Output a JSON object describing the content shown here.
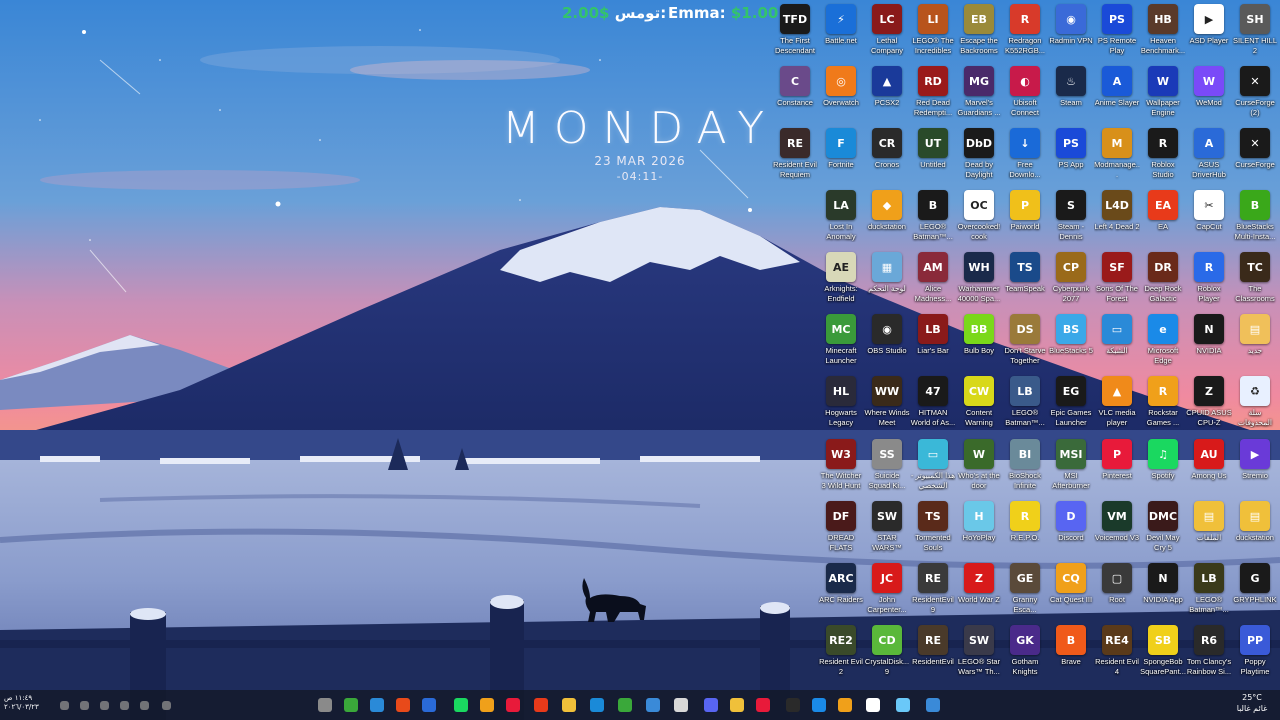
{
  "widget": {
    "day": "MONDAY",
    "date": "23 MAR 2026",
    "time": "-04:11-"
  },
  "topbar": {
    "left_money": "2.00$",
    "left_name": "تومس:",
    "right_name": "Emma:",
    "right_money": "$1.00"
  },
  "colors": {
    "money": "#33c46a",
    "sky_top": "#3a7fd0",
    "sky_mid": "#e27fa0",
    "sky_low": "#f49a6e",
    "mountain": "#283a7a",
    "snow": "#c9d2ea",
    "taskbar": "#121622"
  },
  "icons": [
    [
      "The First Descendant",
      "Battle.net",
      "Lethal Company",
      "LEGO® The Incredibles",
      "Escape the Backrooms",
      "Redragon K552RGB...",
      "Radmin VPN",
      "PS Remote Play",
      "Heaven Benchmark...",
      "ASD Player",
      "SILENT HILL 2"
    ],
    [
      "Constance",
      "Overwatch",
      "PCSX2",
      "Red Dead Redempti...",
      "Marvel's Guardians ...",
      "Ubisoft Connect",
      "Steam",
      "Anime Slayer",
      "Wallpaper Engine",
      "WeMod",
      "CurseForge (2)"
    ],
    [
      "Resident Evil Requiem",
      "Fortnite",
      "Cronos",
      "Untitled",
      "Dead by Daylight",
      "Free Downlo...",
      "PS App",
      "Modmanage...",
      "Roblox Studio",
      "ASUS DriverHub",
      "CurseForge"
    ],
    [
      "Lost In Anomaly",
      "duckstation",
      "LEGO® Batman™...",
      "Overcooked! cook",
      "Paiworld",
      "Steam - Dennis",
      "Left 4 Dead 2",
      "EA",
      "CapCut",
      "BlueStacks Multi-Insta..."
    ],
    [
      "Arknights: Endfield",
      "لوحة التحكم",
      "Alice Madness...",
      "Warhammer 40000 Spa...",
      "TeamSpeak",
      "Cyberpunk 2077",
      "Sons Of The Forest",
      "Deep Rock Galactic",
      "Roblox Player",
      "The Classrooms"
    ],
    [
      "Minecraft Launcher",
      "OBS Studio",
      "Liar's Bar",
      "Bulb Boy",
      "Don't Starve Together",
      "BlueStacks 5",
      "الشبكة",
      "Microsoft Edge",
      "NVIDIA",
      "جديد"
    ],
    [
      "Hogwarts Legacy",
      "Where Winds Meet",
      "HITMAN World of As...",
      "Content Warning",
      "LEGO® Batman™...",
      "Epic Games Launcher",
      "VLC media player",
      "Rockstar Games ...",
      "CPUID ASUS CPU-Z",
      "سلة المحذوفات"
    ],
    [
      "The Witcher 3 Wild Hunt",
      "Suicide Squad Ki...",
      "هذا الكمبيوتر - الشخصي",
      "Who's at the door",
      "BioShock Infinite",
      "MSI Afterburner",
      "Pinterest",
      "Spotify",
      "Among Us",
      "Stremio"
    ],
    [
      "DREAD FLATS",
      "STAR WARS™ Battlefro...",
      "Tormented Souls",
      "HoYoPlay",
      "R.E.P.O.",
      "Discord",
      "Voicemod V3",
      "Devil May Cry 5",
      "الملفات",
      "duckstation"
    ],
    [
      "ARC Raiders",
      "John Carpenter...",
      "ResidentEvil 9",
      "World War Z",
      "Granny Esca...",
      "Cat Quest III",
      "Root",
      "NVIDIA App",
      "LEGO® Batman™...",
      "GRYPHLINK"
    ],
    [
      "Resident Evil 2",
      "CrystalDisk... 9",
      "ResidentEvil",
      "LEGO® Star Wars™ Th...",
      "Gotham Knights",
      "Brave",
      "Resident Evil 4",
      "SpongeBob SquarePant...",
      "Tom Clancy's Rainbow Si...",
      "Poppy Playtime"
    ]
  ],
  "icon_glyphs": [
    [
      "TFD",
      "⚡",
      "LC",
      "LI",
      "EB",
      "R",
      "◉",
      "PS",
      "HB",
      "▶",
      "SH"
    ],
    [
      "C",
      "◎",
      "▲",
      "RD",
      "MG",
      "◐",
      "♨",
      "A",
      "W",
      "W",
      "✕"
    ],
    [
      "RE",
      "F",
      "CR",
      "UT",
      "DbD",
      "↓",
      "PS",
      "M",
      "R",
      "A",
      "✕"
    ],
    [
      "LA",
      "◆",
      "B",
      "OC",
      "P",
      "S",
      "L4D",
      "EA",
      "✂",
      "B"
    ],
    [
      "AE",
      "▦",
      "AM",
      "WH",
      "TS",
      "CP",
      "SF",
      "DR",
      "R",
      "TC"
    ],
    [
      "MC",
      "◉",
      "LB",
      "BB",
      "DS",
      "BS",
      "▭",
      "e",
      "N",
      "▤"
    ],
    [
      "HL",
      "WW",
      "47",
      "CW",
      "LB",
      "EG",
      "▲",
      "R",
      "Z",
      "♻"
    ],
    [
      "W3",
      "SS",
      "▭",
      "W",
      "BI",
      "MSI",
      "P",
      "♫",
      "AU",
      "▶"
    ],
    [
      "DF",
      "SW",
      "TS",
      "H",
      "R",
      "D",
      "VM",
      "DMC",
      "▤",
      "▤"
    ],
    [
      "ARC",
      "JC",
      "RE",
      "Z",
      "GE",
      "CQ",
      "▢",
      "N",
      "LB",
      "G"
    ],
    [
      "RE2",
      "CD",
      "RE",
      "SW",
      "GK",
      "B",
      "RE4",
      "SB",
      "R6",
      "PP"
    ]
  ],
  "icon_colors": [
    [
      "#1a1a1a",
      "#1a6fd8",
      "#8a1a1a",
      "#b8541c",
      "#9a8a3a",
      "#d83a2a",
      "#3a6ad8",
      "#1a4ad8",
      "#5a3a2a",
      "#ffffff",
      "#5a5a5a"
    ],
    [
      "#6a4a8a",
      "#f07a1a",
      "#1a3a9a",
      "#9a1a1a",
      "#4a2a6a",
      "#c81a4a",
      "#1a2a4a",
      "#1a5ad8",
      "#1a3ab8",
      "#7a4af8",
      "#1a1a1a"
    ],
    [
      "#3a2a2a",
      "#1a8ad8",
      "#2a2a2a",
      "#2a4a2a",
      "#1a1a1a",
      "#1a6ad8",
      "#1a4ad8",
      "#d8901a",
      "#1a1a1a",
      "#2a6ad8",
      "#1a1a1a"
    ],
    [
      "#2a3a2a",
      "#f0a01a",
      "#1a1a1a",
      "#ffffff",
      "#f0c01a",
      "#1a1a1a",
      "#6a4a1a",
      "#e83a1a",
      "#ffffff",
      "#3aa81a"
    ],
    [
      "#d8d8b8",
      "#6aa8d8",
      "#8a2a3a",
      "#1a2a4a",
      "#1a4a8a",
      "#9a6a1a",
      "#9a1a1a",
      "#6a2a1a",
      "#2a6ae8",
      "#3a2a1a"
    ],
    [
      "#3a9a3a",
      "#2a2a2a",
      "#8a1a1a",
      "#7ad81a",
      "#9a7a3a",
      "#3aa8e8",
      "#2a8ad8",
      "#1a8ae8",
      "#1a1a1a",
      "#f0c05a"
    ],
    [
      "#2a2a3a",
      "#3a2a1a",
      "#1a1a1a",
      "#d8d81a",
      "#3a5a8a",
      "#1a1a1a",
      "#f08a1a",
      "#f0a01a",
      "#1a1a1a",
      "#e8f0ff"
    ],
    [
      "#8a1a1a",
      "#8a8a8a",
      "#3ab8d8",
      "#3a6a2a",
      "#6a8a9a",
      "#3a6a3a",
      "#e81a3a",
      "#1ad860",
      "#d81a1a",
      "#6a3ad8"
    ],
    [
      "#4a1a1a",
      "#2a2a2a",
      "#5a2a1a",
      "#6ac8e8",
      "#f0d01a",
      "#5865f2",
      "#1a3a2a",
      "#3a1a1a",
      "#f0c03a",
      "#f0c03a"
    ],
    [
      "#1a2a4a",
      "#d81a1a",
      "#3a3a3a",
      "#d81a1a",
      "#5a4a3a",
      "#f0a01a",
      "#3a3a3a",
      "#1a1a1a",
      "#3a3a1a",
      "#1a1a1a"
    ],
    [
      "#3a4a2a",
      "#5ab83a",
      "#4a3a2a",
      "#3a3a4a",
      "#4a2a8a",
      "#f05a1a",
      "#5a3a1a",
      "#f0d01a",
      "#2a2a2a",
      "#3a5ad8"
    ]
  ],
  "taskbar": {
    "left_top": "١١:٤٩ ص",
    "left_bottom": "٢٠٢٦/٠٣/٢٣",
    "temperature": "25°C",
    "weather": "غائم غالبا"
  },
  "taskbar_apps": [
    "#8a8a8a",
    "#3aa83a",
    "#2a8ad8",
    "#e84a1a",
    "#2a6ad8",
    "#1ad860",
    "#f0a01a",
    "#e81a3a",
    "#e83a1a",
    "#f0c03a",
    "#1a8ad8",
    "#3aa83a",
    "#3a8ad8",
    "#d8d8d8",
    "#5865f2",
    "#f0c03a",
    "#e81a3a",
    "#2a2a2a",
    "#1a8ae8",
    "#f0a01a",
    "#ffffff",
    "#6ac8f8",
    "#3a8ad8"
  ]
}
